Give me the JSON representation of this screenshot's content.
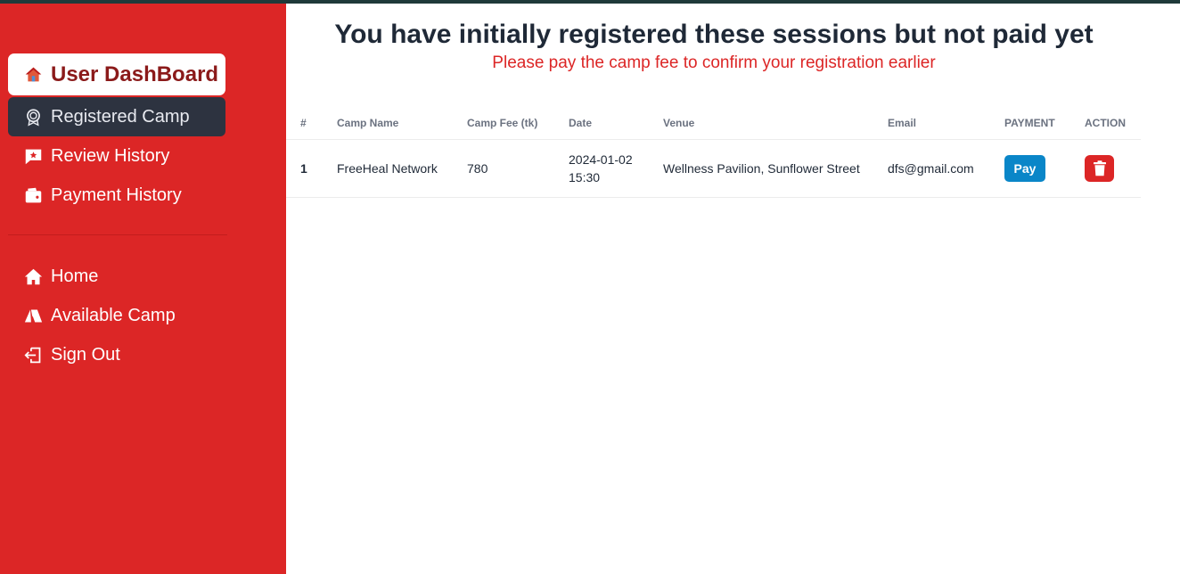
{
  "sidebar": {
    "brand": {
      "label": "User DashBoard",
      "icon": "house-icon"
    },
    "top_items": [
      {
        "label": "Registered Camp",
        "icon": "badge-icon",
        "active": true
      },
      {
        "label": "Review History",
        "icon": "comment-star-icon"
      },
      {
        "label": "Payment History",
        "icon": "wallet-icon"
      }
    ],
    "bottom_items": [
      {
        "label": "Home",
        "icon": "home-icon"
      },
      {
        "label": "Available Camp",
        "icon": "tent-icon"
      },
      {
        "label": "Sign Out",
        "icon": "sign-out-icon"
      }
    ]
  },
  "main": {
    "title": "You have initially registered these sessions but not paid yet",
    "subtitle": "Please pay the camp fee to confirm your registration earlier",
    "table": {
      "headers": [
        "#",
        "Camp Name",
        "Camp Fee (tk)",
        "Date",
        "Venue",
        "Email",
        "PAYMENT",
        "ACTION"
      ],
      "rows": [
        {
          "index": "1",
          "camp_name": "FreeHeal Network",
          "fee": "780",
          "date": "2024-01-02",
          "time": "15:30",
          "venue": "Wellness Pavilion, Sunflower Street",
          "email": "dfs@gmail.com",
          "pay_label": "Pay",
          "action_icon": "trash-icon"
        }
      ]
    }
  },
  "colors": {
    "sidebar_bg": "#dc2626",
    "active_item_bg": "#2d3340",
    "brand_text": "#8b1a1a",
    "pay_button": "#0a86c8",
    "delete_button": "#dc2626",
    "subtitle": "#dc2626"
  }
}
